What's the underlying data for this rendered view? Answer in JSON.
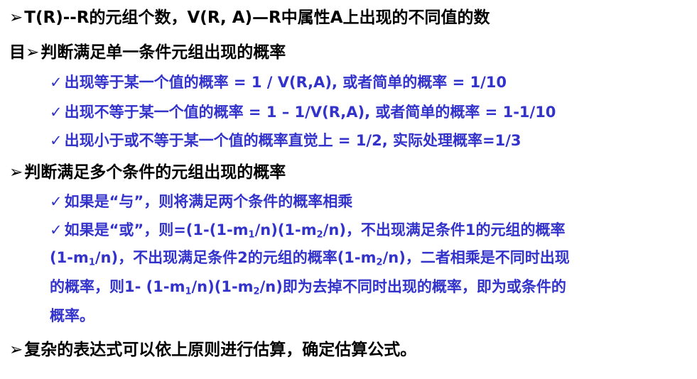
{
  "glyphs": {
    "arrow": "➢",
    "check": "✓"
  },
  "lines": {
    "l1": "T(R)--R的元组个数，V(R, A)—R中属性A上出现的不同值的数",
    "l2_prefix": "目",
    "l2": "判断满足单一条件元组出现的概率",
    "l3": "出现等于某一个值的概率 = 1 / V(R,A), 或者简单的概率 = 1/10",
    "l4": "出现不等于某一个值的概率 = 1 – 1/V(R,A), 或者简单的概率 = 1-1/10",
    "l5": "出现小于或不等于某一个值的概率直觉上 = 1/2, 实际处理概率=1/3",
    "l6": "判断满足多个条件的元组出现的概率",
    "l7": "如果是“与”，则将满足两个条件的概率相乘",
    "l8": {
      "a": "如果是“或”，则=(1-(1-m",
      "s1": "1",
      "b": "/n)(1-m",
      "s2": "2",
      "c": "/n)，不出现满足条件1的元组的概率"
    },
    "l9": {
      "a": "(1-m",
      "s1": "1",
      "b": "/n)，不出现满足条件2的元组的概率(1-m",
      "s2": "2",
      "c": "/n)，二者相乘是不同时出现"
    },
    "l10": {
      "a": "的概率，则1-  (1-m",
      "s1": "1",
      "b": "/n)(1-m",
      "s2": "2",
      "c": "/n)即为去掉不同时出现的概率，即为或条件的"
    },
    "l11": "概率。",
    "l12": "复杂的表达式可以依上原则进行估算，确定估算公式。"
  }
}
